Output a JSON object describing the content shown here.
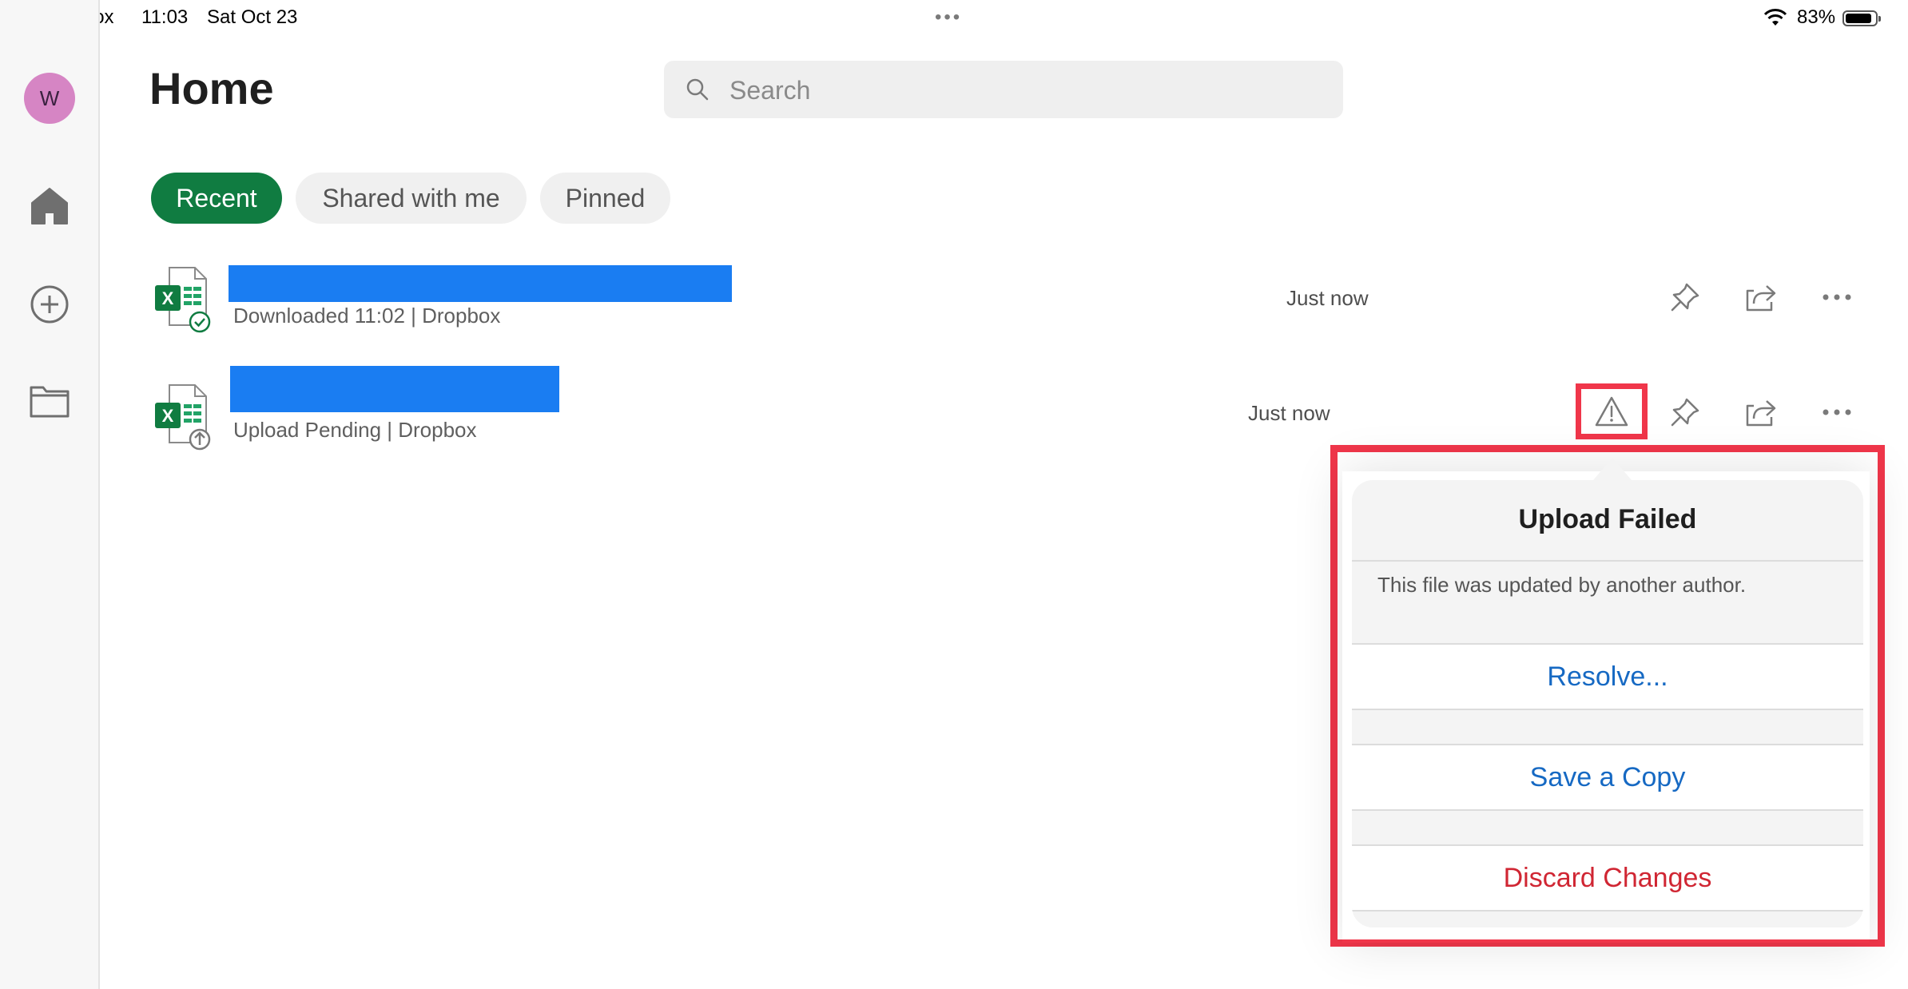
{
  "status_bar": {
    "back_app": "Dropbox",
    "time": "11:03",
    "date": "Sat Oct 23",
    "more": "•••",
    "battery": "83%",
    "battery_level": 0.83
  },
  "sidebar": {
    "avatar_initial": "W",
    "items": [
      {
        "icon": "home-icon"
      },
      {
        "icon": "add-circle-icon"
      },
      {
        "icon": "folder-icon"
      }
    ]
  },
  "header": {
    "title": "Home",
    "search_placeholder": "Search"
  },
  "tabs": [
    {
      "label": "Recent",
      "active": true
    },
    {
      "label": "Shared with me",
      "active": false
    },
    {
      "label": "Pinned",
      "active": false
    }
  ],
  "files": [
    {
      "status": "Downloaded 11:02 | Dropbox",
      "time": "Just now",
      "icon": "excel-synced-icon",
      "name_redacted": true
    },
    {
      "status": "Upload Pending | Dropbox",
      "time": "Just now",
      "icon": "excel-upload-icon",
      "name_redacted": true
    }
  ],
  "popover": {
    "title": "Upload Failed",
    "message": "This file was updated by another author.",
    "actions": [
      "Resolve...",
      "Save a Copy",
      "Discard Changes"
    ]
  },
  "colors": {
    "accent_green": "#107c41",
    "link_blue": "#1669c3",
    "destructive_red": "#d02633",
    "highlight_red": "#f0364a",
    "redaction_blue": "#1a7df2"
  }
}
